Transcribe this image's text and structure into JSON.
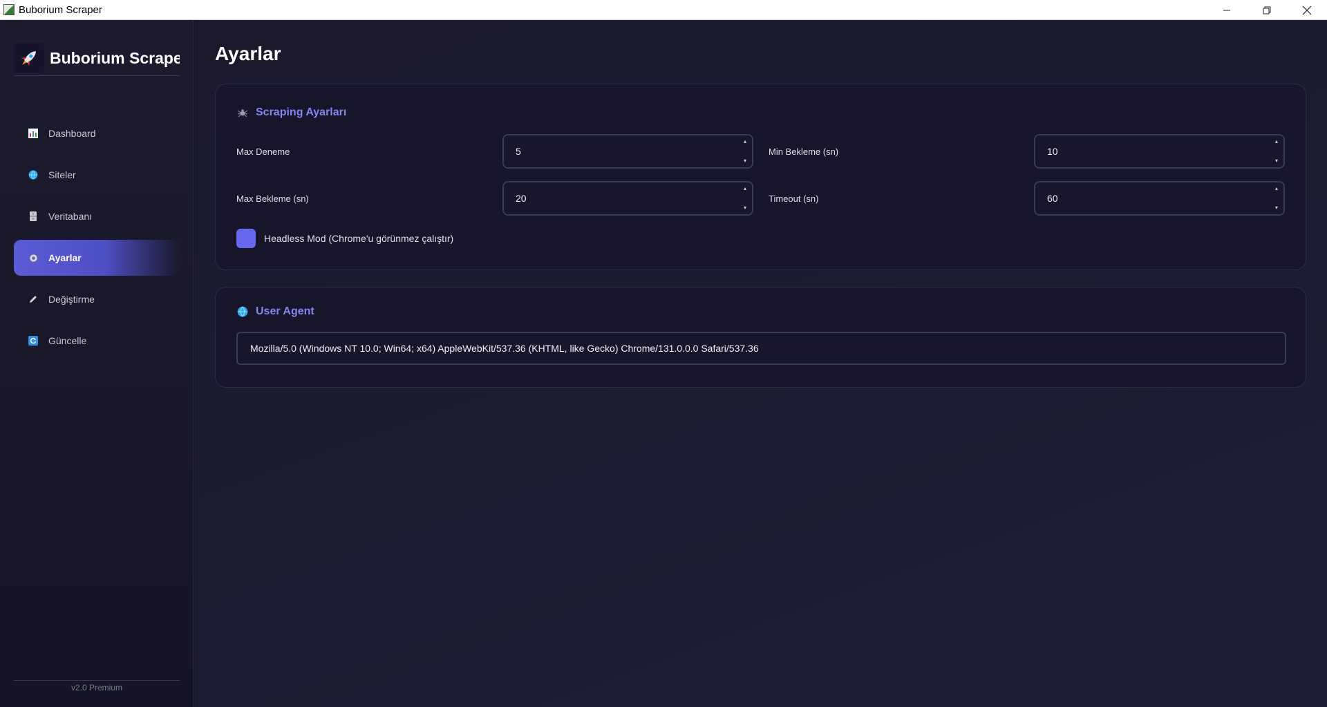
{
  "window": {
    "title": "Buborium Scraper"
  },
  "sidebar": {
    "brand": "Buborium Scraper",
    "items": [
      {
        "label": "Dashboard",
        "icon": "bar-chart-icon"
      },
      {
        "label": "Siteler",
        "icon": "globe-icon"
      },
      {
        "label": "Veritabanı",
        "icon": "cabinet-icon"
      },
      {
        "label": "Ayarlar",
        "icon": "gear-icon",
        "active": true
      },
      {
        "label": "Değiştirme",
        "icon": "pencil-icon"
      },
      {
        "label": "Güncelle",
        "icon": "refresh-icon"
      }
    ],
    "version": "v2.0 Premium"
  },
  "page": {
    "title": "Ayarlar"
  },
  "scraping": {
    "title": "Scraping Ayarları",
    "icon": "spider-icon",
    "max_deneme": {
      "label": "Max Deneme",
      "value": "5"
    },
    "min_bekleme": {
      "label": "Min Bekleme (sn)",
      "value": "10"
    },
    "max_bekleme": {
      "label": "Max Bekleme (sn)",
      "value": "20"
    },
    "timeout": {
      "label": "Timeout (sn)",
      "value": "60"
    },
    "headless": {
      "label": "Headless Mod (Chrome'u görünmez çalıştır)",
      "checked": true
    }
  },
  "user_agent": {
    "title": "User Agent",
    "icon": "globe-icon",
    "value": "Mozilla/5.0 (Windows NT 10.0; Win64; x64) AppleWebKit/537.36 (KHTML, like Gecko) Chrome/131.0.0.0 Safari/537.36"
  },
  "colors": {
    "accent": "#6767ef",
    "card_title": "#8585f0",
    "background": "#1a1a2c"
  }
}
